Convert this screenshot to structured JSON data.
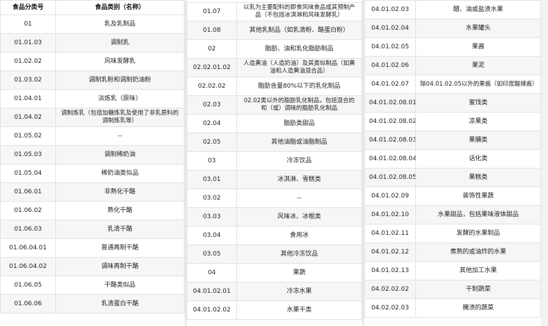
{
  "header": {
    "code": "食品分类号",
    "name": "食品类别（名称）"
  },
  "column1": [
    {
      "code": "01",
      "name": "乳及乳制品"
    },
    {
      "code": "01.01.03",
      "name": "调制乳"
    },
    {
      "code": "01.02.02",
      "name": "风味发酵乳"
    },
    {
      "code": "01.03.02",
      "name": "调制乳粉和调制奶油粉"
    },
    {
      "code": "01.04.01",
      "name": "淡炼乳（原味）"
    },
    {
      "code": "01.04.02",
      "name": "调制炼乳（包括加糖炼乳及使用了非乳原料的调制炼乳等）"
    },
    {
      "code": "01.05.02",
      "name": "--"
    },
    {
      "code": "01.05.03",
      "name": "调制稀奶油"
    },
    {
      "code": "01.05.04",
      "name": "稀奶油类似品"
    },
    {
      "code": "01.06.01",
      "name": "非熟化干酪"
    },
    {
      "code": "01.06.02",
      "name": "熟化干酪"
    },
    {
      "code": "01.06.03",
      "name": "乳清干酪"
    },
    {
      "code": "01.06.04.01",
      "name": "普通再制干酪"
    },
    {
      "code": "01.06.04.02",
      "name": "调味再制干酪"
    },
    {
      "code": "01.06.05",
      "name": "干酪类似品"
    },
    {
      "code": "01.06.06",
      "name": "乳清蛋白干酪"
    }
  ],
  "column2": [
    {
      "code": "01.07",
      "name": "以乳为主要配料的即食风味食品或其预制产品（不包括冰淇淋和风味发酵乳）"
    },
    {
      "code": "01.08",
      "name": "其他乳制品（如乳清粉、酪蛋白粉）"
    },
    {
      "code": "02",
      "name": "脂肪、油和乳化脂肪制品"
    },
    {
      "code": "02.02.01.02",
      "name": "人造黄油（人造奶油）及其类似制品（如黄油和人造黄油混合品）"
    },
    {
      "code": "02.02.02",
      "name": "脂肪含量80%以下的乳化制品"
    },
    {
      "code": "02.03",
      "name": "02.02类以外的脂肪乳化制品，包括混合的和（或）调味的脂肪乳化制品"
    },
    {
      "code": "02.04",
      "name": "脂肪类甜品"
    },
    {
      "code": "02.05",
      "name": "其他油脂或油脂制品"
    },
    {
      "code": "03",
      "name": "冷冻饮品"
    },
    {
      "code": "03.01",
      "name": "冰淇淋、雪糕类"
    },
    {
      "code": "03.02",
      "name": "--"
    },
    {
      "code": "03.03",
      "name": "风味冰、冰棍类"
    },
    {
      "code": "03.04",
      "name": "食用冰"
    },
    {
      "code": "03.05",
      "name": "其他冷冻饮品"
    },
    {
      "code": "04",
      "name": "果蔬"
    },
    {
      "code": "04.01.02.01",
      "name": "冷冻水果"
    },
    {
      "code": "04.01.02.02",
      "name": "水果干类"
    }
  ],
  "column3": [
    {
      "code": "04.01.02.03",
      "name": "醋、油或盐渍水果"
    },
    {
      "code": "04.01.02.04",
      "name": "水果罐头"
    },
    {
      "code": "04.01.02.05",
      "name": "果酱"
    },
    {
      "code": "04.01.02.06",
      "name": "果泥"
    },
    {
      "code": "04.01.02.07",
      "name": "除04.01.02.05以外的果酱（如印度酸辣酱）"
    },
    {
      "code": "04.01.02.08.01",
      "name": "蜜饯类"
    },
    {
      "code": "04.01.02.08.02",
      "name": "凉果类"
    },
    {
      "code": "04.01.02.08.03",
      "name": "果脯类"
    },
    {
      "code": "04.01.02.08.04",
      "name": "话化类"
    },
    {
      "code": "04.01.02.08.05",
      "name": "果糕类"
    },
    {
      "code": "04.01.02.09",
      "name": "装饰性果蔬"
    },
    {
      "code": "04.01.02.10",
      "name": "水果甜品，包括果味液体甜品"
    },
    {
      "code": "04.01.02.11",
      "name": "发酵的水果制品"
    },
    {
      "code": "04.01.02.12",
      "name": "煮熟的或油炸的水果"
    },
    {
      "code": "04.01.02.13",
      "name": "其他加工水果"
    },
    {
      "code": "04.02.02.02",
      "name": "干制蔬菜"
    },
    {
      "code": "04.02.02.03",
      "name": "腌渍的蔬菜"
    }
  ]
}
